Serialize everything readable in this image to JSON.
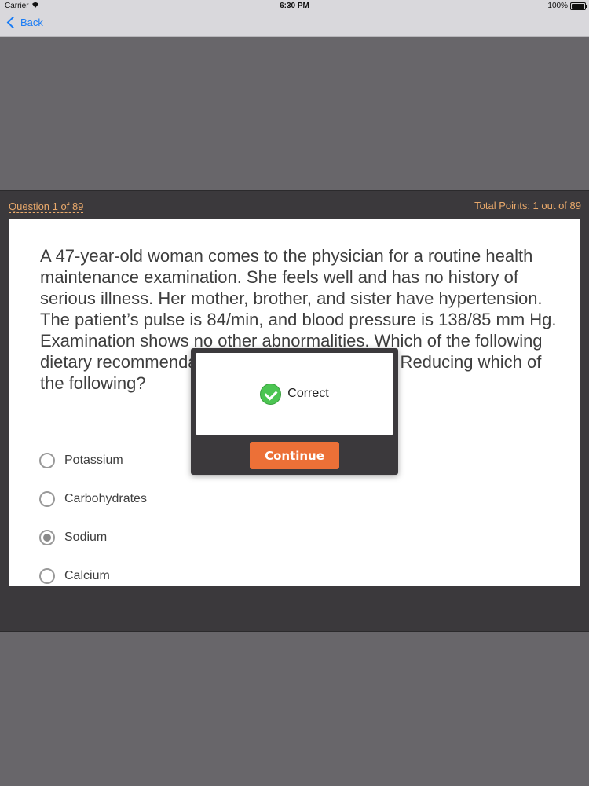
{
  "status_bar": {
    "carrier": "Carrier",
    "time": "6:30 PM",
    "battery": "100%"
  },
  "nav": {
    "back_label": "Back"
  },
  "quiz": {
    "question_counter": "Question 1 of 89",
    "total_points": "Total Points: 1 out of 89",
    "question_text": "A 47-year-old woman comes to the physician for a routine health maintenance examination. She feels well and has no history of serious illness. Her mother, brother, and sister have hypertension. The patient’s pulse is 84/min, and blood pressure is 138/85 mm Hg. Examination shows no other abnormalities. Which of the following dietary recommendations is most appropriate? Reducing which of the following?",
    "options": [
      {
        "label": "Potassium",
        "selected": false
      },
      {
        "label": "Carbohydrates",
        "selected": false
      },
      {
        "label": "Sodium",
        "selected": true
      },
      {
        "label": "Calcium",
        "selected": false
      }
    ]
  },
  "modal": {
    "result_label": "Correct",
    "continue_label": "Continue",
    "icon": "check-circle-icon"
  },
  "colors": {
    "accent_orange": "#ec7037",
    "header_text": "#e9a96b",
    "link_blue": "#1a7cf5",
    "success_green": "#4cc552"
  }
}
